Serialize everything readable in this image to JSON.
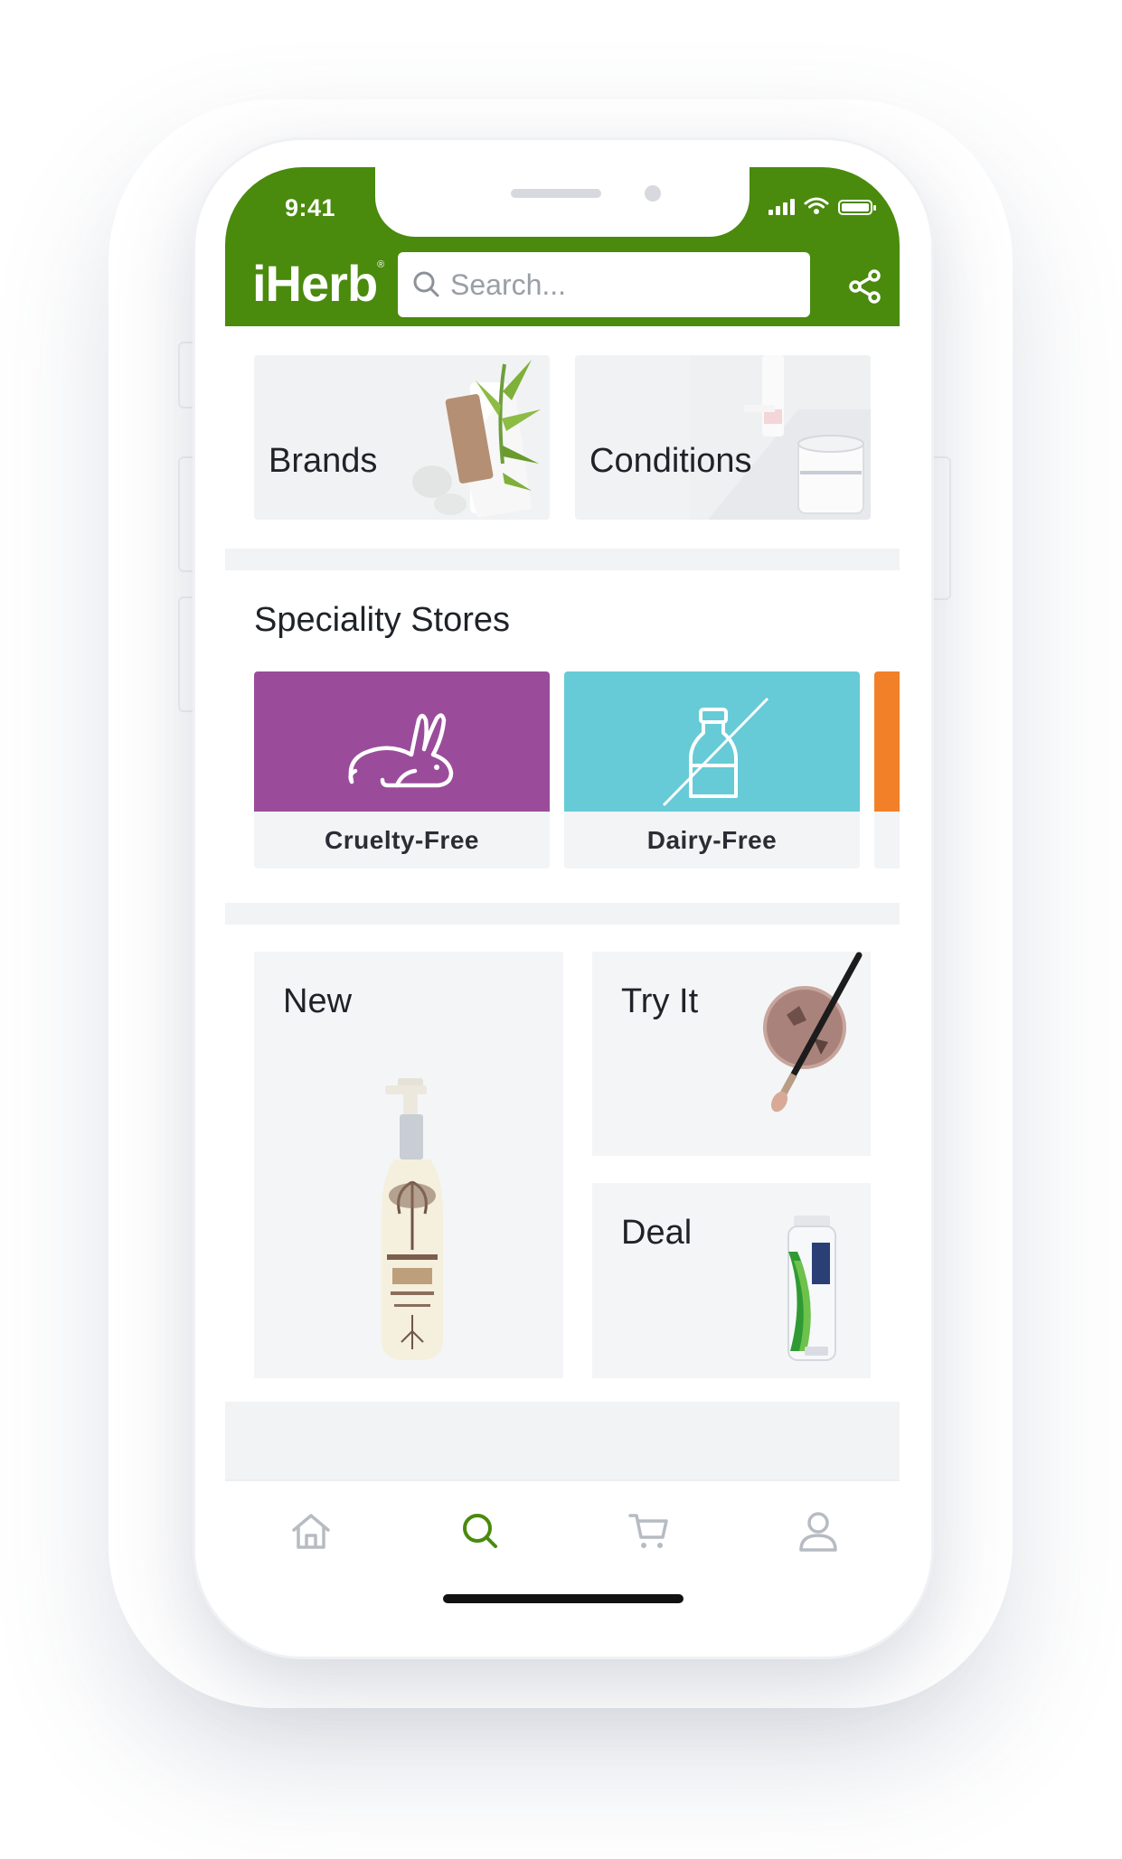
{
  "status_bar": {
    "time": "9:41"
  },
  "header": {
    "logo": "iHerb",
    "logo_mark": "®",
    "search_placeholder": "Search...",
    "brand_color": "#4a8a0d"
  },
  "top_tiles": [
    {
      "label": "Brands"
    },
    {
      "label": "Conditions"
    }
  ],
  "speciality_stores": {
    "title": "Speciality Stores",
    "items": [
      {
        "label": "Cruelty-Free",
        "color": "#9a4c9b",
        "icon": "rabbit-icon"
      },
      {
        "label": "Dairy-Free",
        "color": "#66cbd6",
        "icon": "no-milk-bottle-icon"
      },
      {
        "label": "",
        "color": "#f28028",
        "icon": ""
      }
    ]
  },
  "promos": [
    {
      "label": "New"
    },
    {
      "label": "Try It"
    },
    {
      "label": "Deal"
    }
  ],
  "tab_bar": {
    "tabs": [
      {
        "icon": "home-icon",
        "active": false
      },
      {
        "icon": "search-icon",
        "active": true
      },
      {
        "icon": "cart-icon",
        "active": false
      },
      {
        "icon": "account-icon",
        "active": false
      }
    ],
    "active_color": "#4a8a0d",
    "inactive_color": "#b7bbc2"
  }
}
